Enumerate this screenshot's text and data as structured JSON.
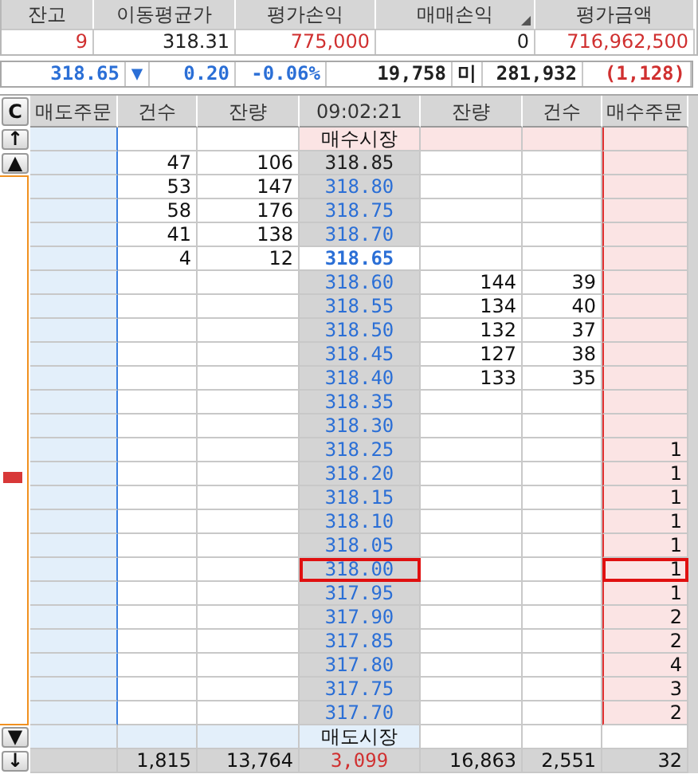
{
  "summary": {
    "columns": [
      "잔고",
      "이동평균가",
      "평가손익",
      "매매손익",
      "평가금액"
    ],
    "values": [
      {
        "text": "9",
        "color": "#d03030"
      },
      {
        "text": "318.31",
        "color": "#202020"
      },
      {
        "text": "775,000",
        "color": "#d03030"
      },
      {
        "text": "0",
        "color": "#202020"
      },
      {
        "text": "716,962,500",
        "color": "#d03030"
      }
    ]
  },
  "quote": [
    {
      "text": "318.65",
      "color": "#2b6fd6"
    },
    {
      "text": "▼",
      "color": "#2b6fd6"
    },
    {
      "text": "0.20",
      "color": "#2b6fd6"
    },
    {
      "text": "-0.06%",
      "color": "#2b6fd6"
    },
    {
      "text": "19,758",
      "color": "#202020"
    },
    {
      "text": "미",
      "color": "#202020"
    },
    {
      "text": "281,932",
      "color": "#202020"
    },
    {
      "text": "(1,128)",
      "color": "#d03030"
    }
  ],
  "order_book": {
    "clear_button": "C",
    "up_button": "↑",
    "page_up_button": "▲",
    "page_down_button": "▼",
    "down_button": "↓",
    "columns": [
      "매도주문",
      "건수",
      "잔량",
      "09:02:21",
      "잔량",
      "건수",
      "매수주문"
    ],
    "buy_market_label": "매수시장",
    "sell_market_label": "매도시장",
    "rows": [
      {
        "price": "318.85",
        "color": "#202020",
        "current": false,
        "selected": false,
        "sell_count": "47",
        "sell_qty": "106"
      },
      {
        "price": "318.80",
        "color": "#2b6fd6",
        "current": false,
        "selected": false,
        "sell_count": "53",
        "sell_qty": "147"
      },
      {
        "price": "318.75",
        "color": "#2b6fd6",
        "current": false,
        "selected": false,
        "sell_count": "58",
        "sell_qty": "176"
      },
      {
        "price": "318.70",
        "color": "#2b6fd6",
        "current": false,
        "selected": false,
        "sell_count": "41",
        "sell_qty": "138"
      },
      {
        "price": "318.65",
        "color": "#2b6fd6",
        "current": true,
        "selected": false,
        "sell_count": "4",
        "sell_qty": "12"
      },
      {
        "price": "318.60",
        "color": "#2b6fd6",
        "current": false,
        "selected": false,
        "buy_qty": "144",
        "buy_count": "39"
      },
      {
        "price": "318.55",
        "color": "#2b6fd6",
        "current": false,
        "selected": false,
        "buy_qty": "134",
        "buy_count": "40"
      },
      {
        "price": "318.50",
        "color": "#2b6fd6",
        "current": false,
        "selected": false,
        "buy_qty": "132",
        "buy_count": "37"
      },
      {
        "price": "318.45",
        "color": "#2b6fd6",
        "current": false,
        "selected": false,
        "buy_qty": "127",
        "buy_count": "38"
      },
      {
        "price": "318.40",
        "color": "#2b6fd6",
        "current": false,
        "selected": false,
        "buy_qty": "133",
        "buy_count": "35"
      },
      {
        "price": "318.35",
        "color": "#2b6fd6",
        "current": false,
        "selected": false
      },
      {
        "price": "318.30",
        "color": "#2b6fd6",
        "current": false,
        "selected": false
      },
      {
        "price": "318.25",
        "color": "#2b6fd6",
        "current": false,
        "selected": false,
        "buy_order": "1"
      },
      {
        "price": "318.20",
        "color": "#2b6fd6",
        "current": false,
        "selected": false,
        "buy_order": "1"
      },
      {
        "price": "318.15",
        "color": "#2b6fd6",
        "current": false,
        "selected": false,
        "buy_order": "1"
      },
      {
        "price": "318.10",
        "color": "#2b6fd6",
        "current": false,
        "selected": false,
        "buy_order": "1"
      },
      {
        "price": "318.05",
        "color": "#2b6fd6",
        "current": false,
        "selected": false,
        "buy_order": "1"
      },
      {
        "price": "318.00",
        "color": "#2b6fd6",
        "current": false,
        "selected": true,
        "buy_order": "1"
      },
      {
        "price": "317.95",
        "color": "#2b6fd6",
        "current": false,
        "selected": false,
        "buy_order": "1"
      },
      {
        "price": "317.90",
        "color": "#2b6fd6",
        "current": false,
        "selected": false,
        "buy_order": "2"
      },
      {
        "price": "317.85",
        "color": "#2b6fd6",
        "current": false,
        "selected": false,
        "buy_order": "2"
      },
      {
        "price": "317.80",
        "color": "#2b6fd6",
        "current": false,
        "selected": false,
        "buy_order": "4"
      },
      {
        "price": "317.75",
        "color": "#2b6fd6",
        "current": false,
        "selected": false,
        "buy_order": "3"
      },
      {
        "price": "317.70",
        "color": "#2b6fd6",
        "current": false,
        "selected": false,
        "buy_order": "2"
      }
    ],
    "totals": {
      "sell_count": "1,815",
      "sell_qty": "13,764",
      "net": "3,099",
      "buy_qty": "16,863",
      "buy_count": "2,551",
      "buy_order": "32"
    }
  }
}
